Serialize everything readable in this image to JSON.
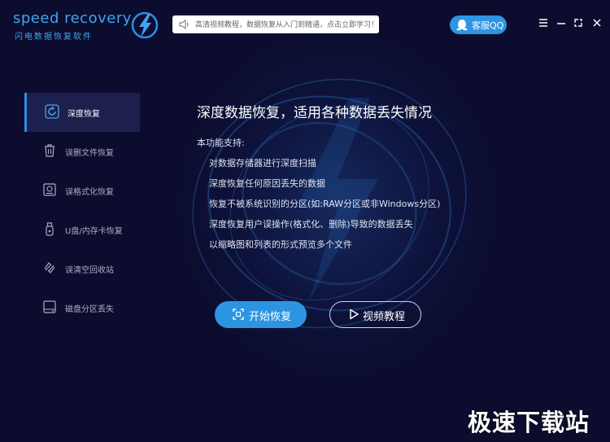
{
  "app": {
    "logo_title": "speed recovery",
    "logo_subtitle": "闪电数据恢复软件",
    "notice_text": "高清视频教程，数据恢复从入门到精通，点击立即学习！",
    "qq_label": "客服QQ"
  },
  "sidebar": {
    "items": [
      {
        "label": "深度恢复",
        "icon": "deep-recover-icon",
        "active": true
      },
      {
        "label": "误删文件恢复",
        "icon": "trash-icon",
        "active": false
      },
      {
        "label": "误格式化恢复",
        "icon": "disk-format-icon",
        "active": false
      },
      {
        "label": "U盘/内存卡恢复",
        "icon": "usb-icon",
        "active": false
      },
      {
        "label": "误清空回收站",
        "icon": "recycle-icon",
        "active": false
      },
      {
        "label": "磁盘分区丢失",
        "icon": "hard-disk-icon",
        "active": false
      }
    ]
  },
  "main": {
    "title": "深度数据恢复，适用各种数据丢失情况",
    "features_heading": "本功能支持:",
    "features": [
      "对数据存储器进行深度扫描",
      "深度恢复任何原因丢失的数据",
      "恢复不被系统识别的分区(如:RAW分区或非Windows分区)",
      "深度恢复用户误操作(格式化、删除)导致的数据丢失",
      "以缩略图和列表的形式预览多个文件"
    ],
    "start_button": "开始恢复",
    "video_button": "视频教程"
  },
  "watermark": "极速下载站",
  "colors": {
    "background": "#0c0d2e",
    "accent": "#2b95e2",
    "sidebar_active": "#1d1f4d"
  }
}
